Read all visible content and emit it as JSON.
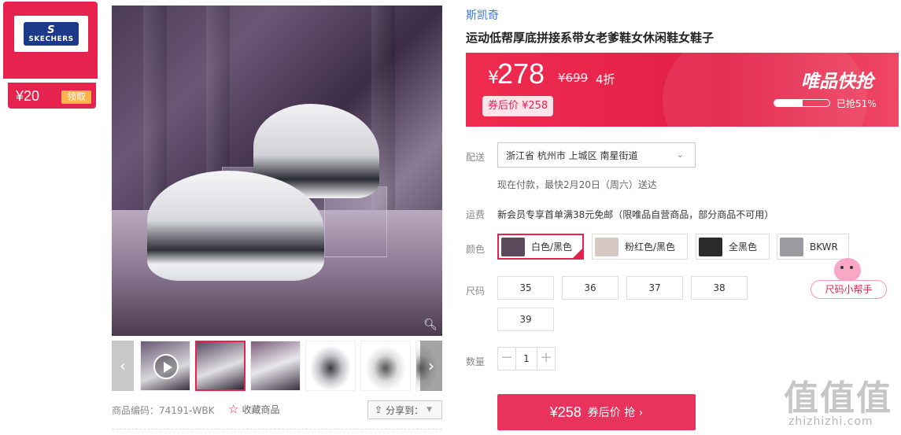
{
  "coupon": {
    "brand_logo_text": "SKECHERS",
    "amount": "¥20",
    "claim_label": "领取"
  },
  "gallery": {
    "thumbnails": [
      "video",
      "image-1",
      "image-2",
      "image-3",
      "image-4",
      "image-5"
    ],
    "selected_index": 1,
    "zoom_icon": "magnifier-icon"
  },
  "product": {
    "brand": "斯凯奇",
    "title": "运动低帮厚底拼接系带女老爹鞋女休闲鞋女鞋子",
    "code_label": "商品编码：74191-WBK",
    "favorite_label": "收藏商品",
    "share_label": "分享到："
  },
  "price": {
    "currency": "¥",
    "current": "278",
    "original": "¥699",
    "discount": "4折",
    "after_coupon": "券后价 ¥258",
    "flash_sale_label": "唯品快抢",
    "sold_progress": 0.51,
    "sold_text": "已抢51%"
  },
  "delivery": {
    "label": "配送",
    "address": "浙江省 杭州市 上城区 南星街道",
    "note": "现在付款，最快2月20日（周六）送达"
  },
  "shipping": {
    "label": "运费",
    "text": "新会员专享首单满38元免邮（限唯品自营商品，部分商品不可用）"
  },
  "colors": {
    "label": "颜色",
    "options": [
      {
        "name": "白色/黑色",
        "swatch": "#5a4a5c",
        "selected": true
      },
      {
        "name": "粉红色/黑色",
        "swatch": "#d8c8c4",
        "selected": false
      },
      {
        "name": "全黑色",
        "swatch": "#2a2a2a",
        "selected": false
      },
      {
        "name": "BKWR",
        "swatch": "#9a9aa0",
        "selected": false
      }
    ]
  },
  "sizes": {
    "label": "尺码",
    "options": [
      "35",
      "36",
      "37",
      "38",
      "39"
    ],
    "helper_label": "尺码小帮手"
  },
  "quantity": {
    "label": "数量",
    "value": "1",
    "minus": "−",
    "plus": "+"
  },
  "buy_button": {
    "price": "¥258",
    "label": "券后价 抢 ›"
  },
  "watermark": {
    "glyphs": "值值值",
    "text": "zhizhizhi.com"
  },
  "colors_theme": {
    "accent": "#e6234f",
    "link": "#3a7bd5"
  }
}
